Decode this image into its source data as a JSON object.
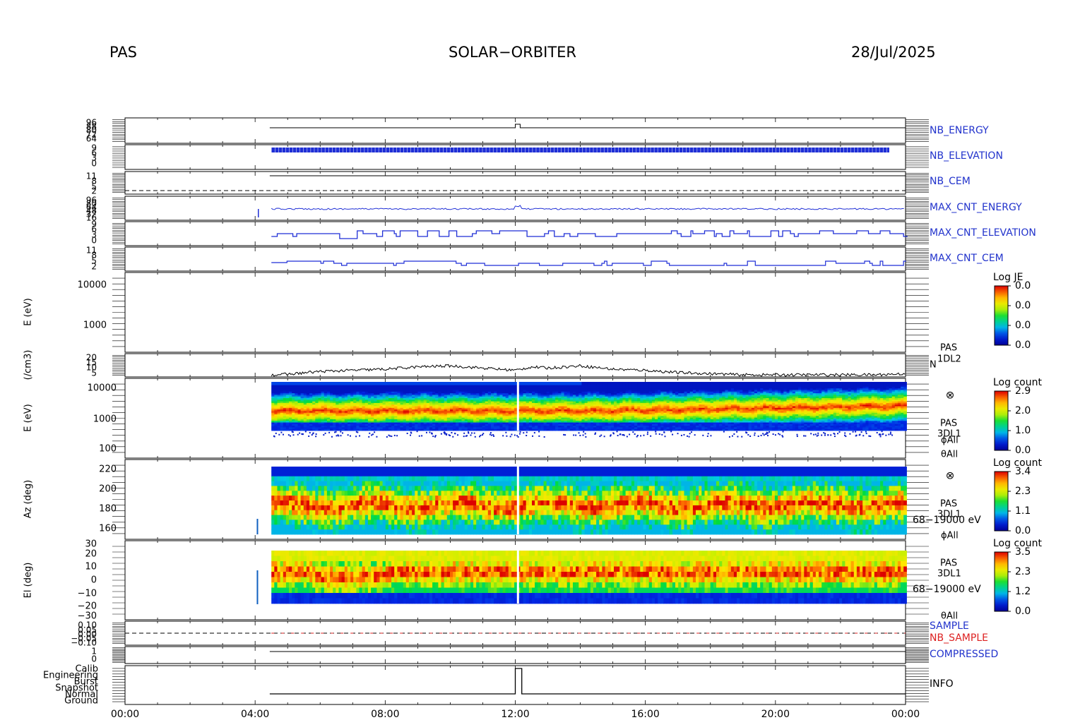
{
  "header": {
    "instrument": "PAS",
    "mission": "SOLAR−ORBITER",
    "date": "28/Jul/2025"
  },
  "colors": {
    "trace": "#1f2fd6",
    "label_blue": "#2233cc",
    "label_red": "#dd2222",
    "density_trace": "#000000"
  },
  "chart_data": {
    "type": "multi-panel time series / spectrogram",
    "x_ticks": [
      "00:00",
      "04:00",
      "08:00",
      "12:00",
      "16:00",
      "20:00",
      "00:00"
    ],
    "x_range_hours": [
      0,
      24
    ],
    "panels": [
      {
        "id": "nb_energy",
        "label": "NB_ENERGY",
        "tick_labels": [
          "96",
          "88",
          "80",
          "72",
          "64"
        ],
        "x": [
          0,
          4.45,
          12,
          12.1,
          24
        ],
        "y": [
          0.2,
          0.2,
          0.2,
          0.3,
          0.2
        ]
      },
      {
        "id": "nb_elevation",
        "label": "NB_ELEVATION",
        "tick_labels": [
          "9",
          "6",
          "3",
          "0"
        ]
      },
      {
        "id": "nb_cem",
        "label": "NB_CEM",
        "tick_labels": [
          "11",
          "8",
          "5",
          "2"
        ]
      },
      {
        "id": "max_cnt_energy",
        "label": "MAX_CNT_ENERGY",
        "tick_labels": [
          "96",
          "80",
          "64",
          "48",
          "32",
          "16"
        ]
      },
      {
        "id": "max_cnt_elevation",
        "label": "MAX_CNT_ELEVATION",
        "tick_labels": [
          "9",
          "6",
          "3",
          "0"
        ]
      },
      {
        "id": "max_cnt_cem",
        "label": "MAX_CNT_CEM",
        "tick_labels": [
          "11",
          "8",
          "5",
          "2"
        ]
      },
      {
        "id": "je_spectrogram",
        "ylabel": "E (eV)",
        "y_tick_labels": [
          "10000",
          "1000"
        ],
        "colorbar": {
          "title": "Log JE",
          "ticks": [
            "0.0",
            "0.0",
            "0.0",
            "0.0"
          ]
        }
      },
      {
        "id": "density",
        "ylabel": "(/cm3)",
        "y_tick_labels": [
          "20",
          "15",
          "10",
          "5"
        ],
        "right_labels": [
          "PAS",
          "1DL2",
          "N"
        ],
        "x": [
          4.5,
          5,
          6,
          7,
          8,
          9,
          10,
          11,
          12,
          12.5,
          13,
          14,
          15,
          16,
          17,
          18,
          19,
          20,
          21,
          22,
          23,
          24
        ],
        "y": [
          5,
          5.5,
          8,
          9,
          10,
          12,
          13,
          11,
          9,
          12,
          11,
          13,
          10,
          9,
          7,
          6,
          5,
          5,
          5,
          5,
          5,
          6
        ]
      },
      {
        "id": "energy_spectrogram",
        "ylabel": "E (eV)",
        "y_tick_labels": [
          "10000",
          "1000",
          "100"
        ],
        "right_labels": [
          "⊗",
          "PAS",
          "3DL1",
          "ϕAll",
          "θAll"
        ],
        "colorbar": {
          "title": "Log count",
          "ticks": [
            "2.9",
            "2.0",
            "1.0",
            "0.0"
          ]
        }
      },
      {
        "id": "azimuth_spectrogram",
        "ylabel": "Az (deg)",
        "y_tick_labels": [
          "220",
          "200",
          "180",
          "160"
        ],
        "right_labels": [
          "⊗",
          "PAS",
          "3DL1",
          "68−19000 eV",
          "ϕAll"
        ],
        "colorbar": {
          "title": "Log count",
          "ticks": [
            "3.4",
            "2.3",
            "1.1",
            "0.0"
          ]
        }
      },
      {
        "id": "elevation_spectrogram",
        "ylabel": "El (deg)",
        "y_tick_labels": [
          "30",
          "20",
          "10",
          "0",
          "−10",
          "−20",
          "−30"
        ],
        "right_labels": [
          "PAS",
          "3DL1",
          "68−19000 eV",
          "θAll"
        ],
        "colorbar": {
          "title": "Log count",
          "ticks": [
            "3.5",
            "2.3",
            "1.2",
            "0.0"
          ]
        }
      },
      {
        "id": "sample",
        "labels": [
          "SAMPLE",
          "NB_SAMPLE"
        ],
        "tick_labels": [
          "0.10",
          "0.05",
          "0.00",
          "−0.05",
          "−0.10"
        ]
      },
      {
        "id": "compressed",
        "label": "COMPRESSED",
        "tick_labels": [
          "1",
          "0"
        ]
      },
      {
        "id": "info",
        "label": "INFO",
        "tick_labels": [
          "Calib",
          "Engineering",
          "Burst",
          "Snapshot",
          "Normal",
          "Ground"
        ]
      }
    ]
  }
}
